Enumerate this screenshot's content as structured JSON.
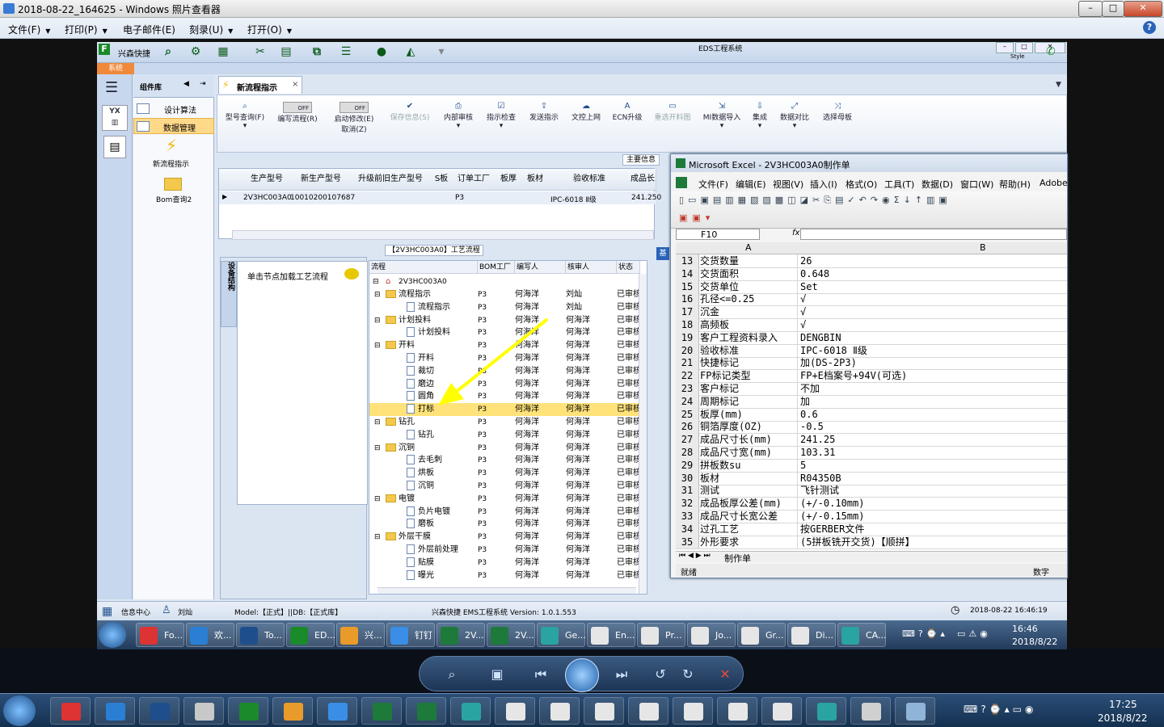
{
  "viewer": {
    "title": "2018-08-22_164625 - Windows 照片查看器",
    "menu": [
      {
        "label": "文件(F)"
      },
      {
        "label": "打印(P)"
      },
      {
        "label": "电子邮件(E)"
      },
      {
        "label": "刻录(U)"
      },
      {
        "label": "打开(O)"
      }
    ],
    "clock": {
      "time": "17:25",
      "date": "2018/8/22"
    }
  },
  "eds": {
    "window_title": "EDS工程系统",
    "app_name": "兴森快捷",
    "system_tab": "系统",
    "style_label": "Style",
    "component_panel_title": "组件库",
    "component_items": [
      {
        "label": "设计算法"
      },
      {
        "label": "数据管理"
      }
    ],
    "panel_shortcuts": [
      {
        "label": "新流程指示"
      },
      {
        "label": "Bom查询2"
      }
    ],
    "doc_tab": "新流程指示",
    "ribbon": [
      {
        "label": "型号查询(F)"
      },
      {
        "label": "编写流程(R)",
        "toggle": "OFF"
      },
      {
        "label": "启动修改(E)",
        "toggle": "OFF",
        "sub": "取消(Z)"
      },
      {
        "label": "保存信息(S)"
      },
      {
        "label": "内部审核"
      },
      {
        "label": "指示检查"
      },
      {
        "label": "发送指示"
      },
      {
        "label": "文控上网"
      },
      {
        "label": "ECN升级"
      },
      {
        "label": "重选开料图"
      },
      {
        "label": "MI数据导入"
      },
      {
        "label": "集成"
      },
      {
        "label": "数据对比"
      },
      {
        "label": "选择母板"
      }
    ],
    "main_info_tab": "主要信息",
    "grid": {
      "headers": [
        "生产型号",
        "新生产型号",
        "升级前旧生产型号",
        "S板",
        "订单工厂",
        "板厚",
        "板材",
        "验收标准",
        "成品长度"
      ],
      "row": [
        "2V3HC003A0",
        "10010200107687",
        "",
        "",
        "P3",
        "",
        "",
        "IPC-6018 Ⅱ级",
        "241.250"
      ]
    },
    "process_title": "【2V3HC003A0】工艺流程",
    "side_vertical": "设备结构",
    "load_hint": "单击节点加载工艺流程",
    "base_tab": "基",
    "tree_headers": [
      "流程",
      "BOM工厂",
      "编写人",
      "核审人",
      "状态"
    ],
    "tree_root": "2V3HC003A0",
    "tree": [
      {
        "name": "流程指示",
        "folder": true,
        "level": 1,
        "bom": "P3",
        "writer": "何海洋",
        "checker": "刘灿",
        "status": "已审核"
      },
      {
        "name": "流程指示",
        "folder": false,
        "level": 2,
        "bom": "P3",
        "writer": "何海洋",
        "checker": "刘灿",
        "status": "已审核"
      },
      {
        "name": "计划投料",
        "folder": true,
        "level": 1,
        "bom": "P3",
        "writer": "何海洋",
        "checker": "何海洋",
        "status": "已审核"
      },
      {
        "name": "计划投料",
        "folder": false,
        "level": 2,
        "bom": "P3",
        "writer": "何海洋",
        "checker": "何海洋",
        "status": "已审核"
      },
      {
        "name": "开料",
        "folder": true,
        "level": 1,
        "bom": "P3",
        "writer": "何海洋",
        "checker": "何海洋",
        "status": "已审核"
      },
      {
        "name": "开料",
        "folder": false,
        "level": 2,
        "bom": "P3",
        "writer": "何海洋",
        "checker": "何海洋",
        "status": "已审核"
      },
      {
        "name": "裁切",
        "folder": false,
        "level": 2,
        "bom": "P3",
        "writer": "何海洋",
        "checker": "何海洋",
        "status": "已审核"
      },
      {
        "name": "磨边",
        "folder": false,
        "level": 2,
        "bom": "P3",
        "writer": "何海洋",
        "checker": "何海洋",
        "status": "已审核"
      },
      {
        "name": "圆角",
        "folder": false,
        "level": 2,
        "bom": "P3",
        "writer": "何海洋",
        "checker": "何海洋",
        "status": "已审核"
      },
      {
        "name": "打标",
        "folder": false,
        "level": 2,
        "bom": "P3",
        "writer": "何海洋",
        "checker": "何海洋",
        "status": "已审核",
        "selected": true
      },
      {
        "name": "钻孔",
        "folder": true,
        "level": 1,
        "bom": "P3",
        "writer": "何海洋",
        "checker": "何海洋",
        "status": "已审核"
      },
      {
        "name": "钻孔",
        "folder": false,
        "level": 2,
        "bom": "P3",
        "writer": "何海洋",
        "checker": "何海洋",
        "status": "已审核"
      },
      {
        "name": "沉铜",
        "folder": true,
        "level": 1,
        "bom": "P3",
        "writer": "何海洋",
        "checker": "何海洋",
        "status": "已审核"
      },
      {
        "name": "去毛刺",
        "folder": false,
        "level": 2,
        "bom": "P3",
        "writer": "何海洋",
        "checker": "何海洋",
        "status": "已审核"
      },
      {
        "name": "烘板",
        "folder": false,
        "level": 2,
        "bom": "P3",
        "writer": "何海洋",
        "checker": "何海洋",
        "status": "已审核"
      },
      {
        "name": "沉铜",
        "folder": false,
        "level": 2,
        "bom": "P3",
        "writer": "何海洋",
        "checker": "何海洋",
        "status": "已审核"
      },
      {
        "name": "电镀",
        "folder": true,
        "level": 1,
        "bom": "P3",
        "writer": "何海洋",
        "checker": "何海洋",
        "status": "已审核"
      },
      {
        "name": "负片电镀",
        "folder": false,
        "level": 2,
        "bom": "P3",
        "writer": "何海洋",
        "checker": "何海洋",
        "status": "已审核"
      },
      {
        "name": "磨板",
        "folder": false,
        "level": 2,
        "bom": "P3",
        "writer": "何海洋",
        "checker": "何海洋",
        "status": "已审核"
      },
      {
        "name": "外层干膜",
        "folder": true,
        "level": 1,
        "bom": "P3",
        "writer": "何海洋",
        "checker": "何海洋",
        "status": "已审核"
      },
      {
        "name": "外层前处理",
        "folder": false,
        "level": 2,
        "bom": "P3",
        "writer": "何海洋",
        "checker": "何海洋",
        "status": "已审核"
      },
      {
        "name": "贴膜",
        "folder": false,
        "level": 2,
        "bom": "P3",
        "writer": "何海洋",
        "checker": "何海洋",
        "status": "已审核"
      },
      {
        "name": "曝光",
        "folder": false,
        "level": 2,
        "bom": "P3",
        "writer": "何海洋",
        "checker": "何海洋",
        "status": "已审核"
      }
    ],
    "status_bar": {
      "info_center": "信息中心",
      "user": "刘灿",
      "model": "Model:【正式】||DB:【正式库】",
      "version": "兴森快捷 EMS工程系统 Version: 1.0.1.553",
      "datetime": "2018-08-22 16:46:19"
    }
  },
  "excel": {
    "title": "Microsoft Excel - 2V3HC003A0制作单",
    "menu": [
      "文件(F)",
      "编辑(E)",
      "视图(V)",
      "插入(I)",
      "格式(O)",
      "工具(T)",
      "数据(D)",
      "窗口(W)",
      "帮助(H)",
      "Adobe"
    ],
    "name_box": "F10",
    "fx": "fx",
    "col_a": "A",
    "col_b": "B",
    "rows": [
      {
        "n": "13",
        "a": "交货数量",
        "b": "26"
      },
      {
        "n": "14",
        "a": "交货面积",
        "b": "0.648"
      },
      {
        "n": "15",
        "a": "交货单位",
        "b": "Set"
      },
      {
        "n": "16",
        "a": "孔径<=0.25",
        "b": "√"
      },
      {
        "n": "17",
        "a": "沉金",
        "b": "√"
      },
      {
        "n": "18",
        "a": "高频板",
        "b": "√"
      },
      {
        "n": "19",
        "a": "客户工程资料录入",
        "b": "DENGBIN"
      },
      {
        "n": "20",
        "a": "验收标准",
        "b": "IPC-6018 Ⅱ级"
      },
      {
        "n": "21",
        "a": "快捷标记",
        "b": "加(DS-2P3)"
      },
      {
        "n": "22",
        "a": "FP标记类型",
        "b": "FP+E档案号+94V(可选)"
      },
      {
        "n": "23",
        "a": "客户标记",
        "b": "不加"
      },
      {
        "n": "24",
        "a": "周期标记",
        "b": "加"
      },
      {
        "n": "25",
        "a": "板厚(mm)",
        "b": "0.6"
      },
      {
        "n": "26",
        "a": "铜箔厚度(OZ)",
        "b": "-0.5"
      },
      {
        "n": "27",
        "a": "成品尺寸长(mm)",
        "b": "241.25"
      },
      {
        "n": "28",
        "a": "成品尺寸宽(mm)",
        "b": "103.31"
      },
      {
        "n": "29",
        "a": "拼板数su",
        "b": "5"
      },
      {
        "n": "30",
        "a": "板材",
        "b": "R04350B"
      },
      {
        "n": "31",
        "a": "测试",
        "b": "飞针测试"
      },
      {
        "n": "32",
        "a": "成品板厚公差(mm)",
        "b": "(+/-0.10mm)"
      },
      {
        "n": "33",
        "a": "成品尺寸长宽公差",
        "b": "(+/-0.15mm)"
      },
      {
        "n": "34",
        "a": "过孔工艺",
        "b": "按GERBER文件"
      },
      {
        "n": "35",
        "a": "外形要求",
        "b": "(5拼板铣开交货)【顺拼】"
      }
    ],
    "sheet_tab": "制作单",
    "status_left": "就绪",
    "status_right": "数字"
  },
  "inner_taskbar": {
    "items": [
      {
        "label": "Fo..."
      },
      {
        "label": "欢..."
      },
      {
        "label": "To..."
      },
      {
        "label": "ED..."
      },
      {
        "label": "兴..."
      },
      {
        "label": "钉钉"
      },
      {
        "label": "2V..."
      },
      {
        "label": "2V..."
      },
      {
        "label": "Ge..."
      },
      {
        "label": "En..."
      },
      {
        "label": "Pr..."
      },
      {
        "label": "Jo..."
      },
      {
        "label": "Gr..."
      },
      {
        "label": "Di..."
      },
      {
        "label": "CA..."
      }
    ],
    "clock": {
      "time": "16:46",
      "date": "2018/8/22"
    }
  },
  "colors": {
    "accent_blue": "#1f4e8c",
    "selection_yellow": "#ffe27a",
    "arrow_yellow": "#ffff00"
  }
}
